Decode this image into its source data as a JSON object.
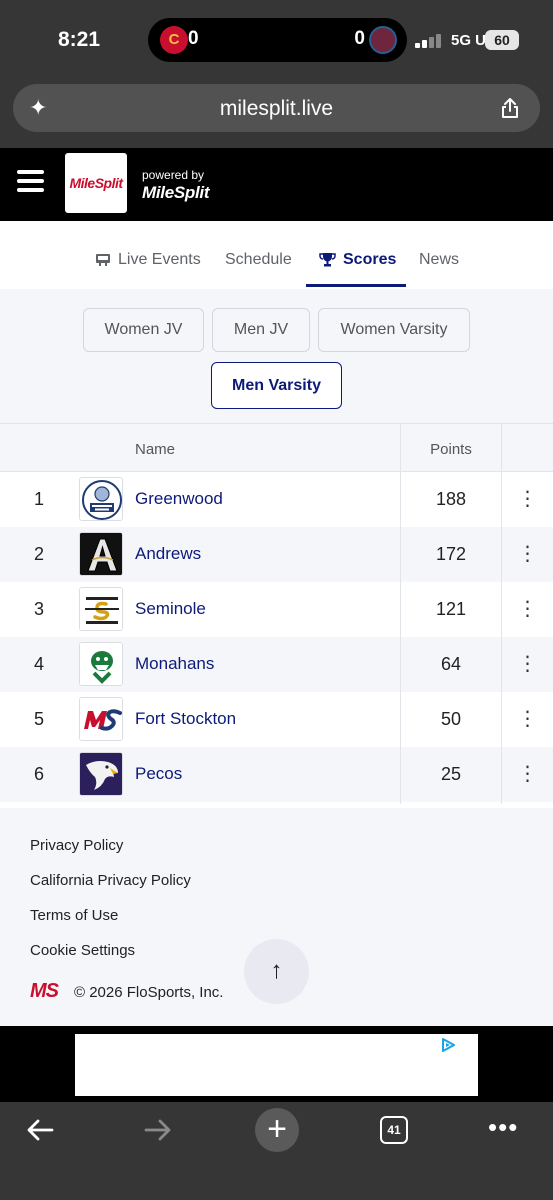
{
  "status_bar": {
    "time": "8:21",
    "left_score": "0",
    "right_score": "0",
    "network": "5G UW",
    "battery": "60"
  },
  "browser": {
    "url": "milesplit.live"
  },
  "header": {
    "logo_text": "MileSplit",
    "powered_by": "powered by",
    "powered_brand": "MileSplit"
  },
  "tabs": [
    {
      "label": "Live Events",
      "active": false
    },
    {
      "label": "Schedule",
      "active": false
    },
    {
      "label": "Scores",
      "active": true
    },
    {
      "label": "News",
      "active": false
    }
  ],
  "filters": [
    {
      "label": "Women JV",
      "active": false
    },
    {
      "label": "Men JV",
      "active": false
    },
    {
      "label": "Women Varsity",
      "active": false
    },
    {
      "label": "Men Varsity",
      "active": true
    }
  ],
  "table": {
    "headers": {
      "name": "Name",
      "points": "Points"
    },
    "rows": [
      {
        "rank": "1",
        "team": "Greenwood",
        "points": "188",
        "logo_icon": "greenwood-logo"
      },
      {
        "rank": "2",
        "team": "Andrews",
        "points": "172",
        "logo_icon": "andrews-logo"
      },
      {
        "rank": "3",
        "team": "Seminole",
        "points": "121",
        "logo_icon": "seminole-logo"
      },
      {
        "rank": "4",
        "team": "Monahans",
        "points": "64",
        "logo_icon": "monahans-logo"
      },
      {
        "rank": "5",
        "team": "Fort Stockton",
        "points": "50",
        "logo_icon": "fort-stockton-logo"
      },
      {
        "rank": "6",
        "team": "Pecos",
        "points": "25",
        "logo_icon": "pecos-logo"
      }
    ]
  },
  "footer": {
    "links": [
      "Privacy Policy",
      "California Privacy Policy",
      "Terms of Use",
      "Cookie Settings"
    ],
    "logo_text": "MS",
    "copyright": "© 2026 FloSports, Inc.",
    "scroll_top": "↑"
  },
  "bottom_bar": {
    "tab_count": "41"
  },
  "colors": {
    "brand_navy": "#0d1a78",
    "brand_red": "#c8102e",
    "header_bg": "#000000",
    "chrome_bg": "#363636"
  }
}
